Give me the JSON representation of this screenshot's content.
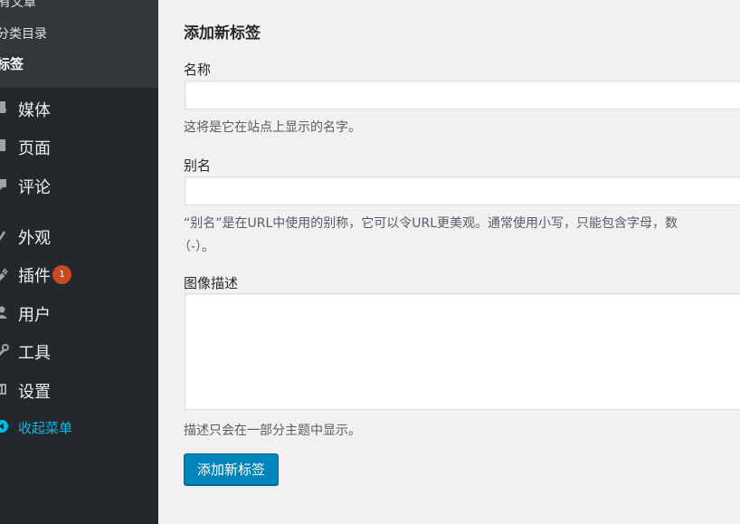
{
  "sidebar": {
    "submenu": [
      {
        "label": "有文章"
      },
      {
        "label": "分类目录"
      },
      {
        "label": "标签",
        "current": true
      }
    ],
    "menu": [
      {
        "label": "媒体",
        "icon": "media-icon"
      },
      {
        "label": "页面",
        "icon": "page-icon"
      },
      {
        "label": "评论",
        "icon": "comment-icon"
      },
      {
        "label": "外观",
        "icon": "appearance-icon"
      },
      {
        "label": "插件",
        "icon": "plugin-icon",
        "badge": "1"
      },
      {
        "label": "用户",
        "icon": "user-icon"
      },
      {
        "label": "工具",
        "icon": "tools-icon"
      },
      {
        "label": "设置",
        "icon": "settings-icon"
      }
    ],
    "collapse_label": "收起菜单",
    "colors": {
      "background": "#23282d",
      "submenu_background": "#32373c",
      "collapse_accent": "#00b9eb",
      "badge": "#ca4a1f"
    }
  },
  "form": {
    "title": "添加新标签",
    "name_label": "名称",
    "name_value": "",
    "name_hint": "这将是它在站点上显示的名字。",
    "slug_label": "别名",
    "slug_value": "",
    "slug_hint_line1": "“别名”是在URL中使用的别称，它可以令URL更美观。通常使用小写，只能包含字母，数",
    "slug_hint_line2": "（-）。",
    "description_label": "图像描述",
    "description_value": "",
    "description_hint": "描述只会在一部分主题中显示。",
    "submit_label": "添加新标签",
    "submit_color": "#0085ba"
  }
}
